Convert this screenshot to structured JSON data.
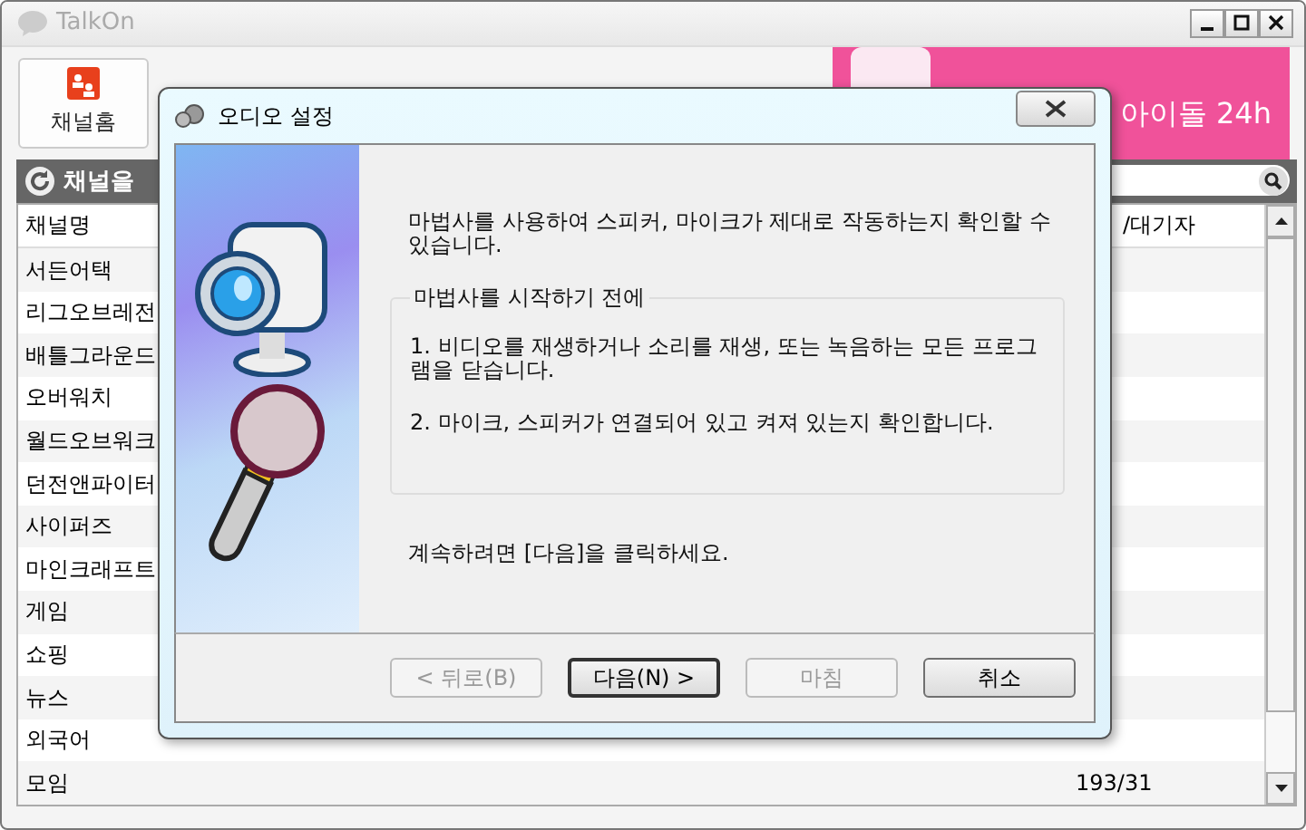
{
  "window": {
    "title": "TalkOn"
  },
  "toolbar": {
    "home_button": "채널홈"
  },
  "ad_banner": {
    "text": "아이돌 24h"
  },
  "channel_panel": {
    "title": "채널을"
  },
  "table": {
    "columns": [
      "채널명",
      "/대기자"
    ],
    "rows": [
      {
        "name": "서든어택"
      },
      {
        "name": "리그오브레전"
      },
      {
        "name": "배틀그라운드"
      },
      {
        "name": "오버워치"
      },
      {
        "name": "월드오브워크"
      },
      {
        "name": "던전앤파이터"
      },
      {
        "name": "사이퍼즈"
      },
      {
        "name": "마인크래프트"
      },
      {
        "name": "게임"
      },
      {
        "name": "쇼핑"
      },
      {
        "name": "뉴스"
      },
      {
        "name": "외국어"
      },
      {
        "name": "모임",
        "count": "193/31"
      }
    ]
  },
  "dialog": {
    "title": "오디오 설정",
    "intro": "마법사를 사용하여 스피커, 마이크가 제대로 작동하는지 확인할 수 있습니다.",
    "group_title": "마법사를 시작하기 전에",
    "steps": [
      "1. 비디오를 재생하거나 소리를 재생, 또는 녹음하는 모든 프로그램을 닫습니다.",
      "2. 마이크, 스피커가 연결되어 있고 켜져 있는지 확인합니다."
    ],
    "footer_text": "계속하려면 [다음]을 클릭하세요.",
    "buttons": [
      {
        "label": "< 뒤로(B)",
        "disabled": true,
        "default": false
      },
      {
        "label": "다음(N) >",
        "disabled": false,
        "default": true
      },
      {
        "label": "마침",
        "disabled": true,
        "default": false
      },
      {
        "label": "취소",
        "disabled": false,
        "default": false
      }
    ]
  }
}
